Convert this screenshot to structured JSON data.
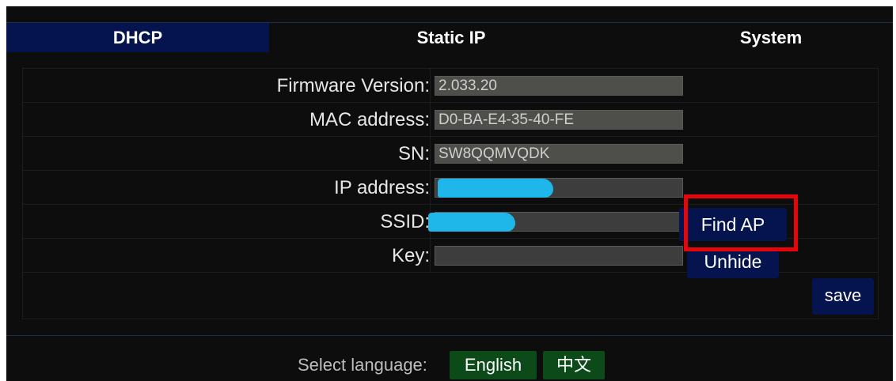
{
  "tabs": [
    {
      "label": "DHCP",
      "active": true
    },
    {
      "label": "Static IP",
      "active": false
    },
    {
      "label": "System",
      "active": false
    }
  ],
  "form": {
    "firmware": {
      "label": "Firmware Version:",
      "value": "2.033.20"
    },
    "mac": {
      "label": "MAC address:",
      "value": "D0-BA-E4-35-40-FE"
    },
    "sn": {
      "label": "SN:",
      "value": "SW8QQMVQDK"
    },
    "ip": {
      "label": "IP address:",
      "value": ""
    },
    "ssid": {
      "label": "SSID:",
      "value": ""
    },
    "key": {
      "label": "Key:",
      "value": ""
    }
  },
  "buttons": {
    "find_ap": "Find AP",
    "unhide": "Unhide",
    "save": "save"
  },
  "language": {
    "label": "Select language:",
    "options": [
      "English",
      "中文"
    ]
  },
  "colors": {
    "active_tab": "#05144e",
    "button": "#05144e",
    "language_button": "#0c4a1a",
    "highlight_box": "#e5050a",
    "redaction": "#1fb7ea"
  }
}
